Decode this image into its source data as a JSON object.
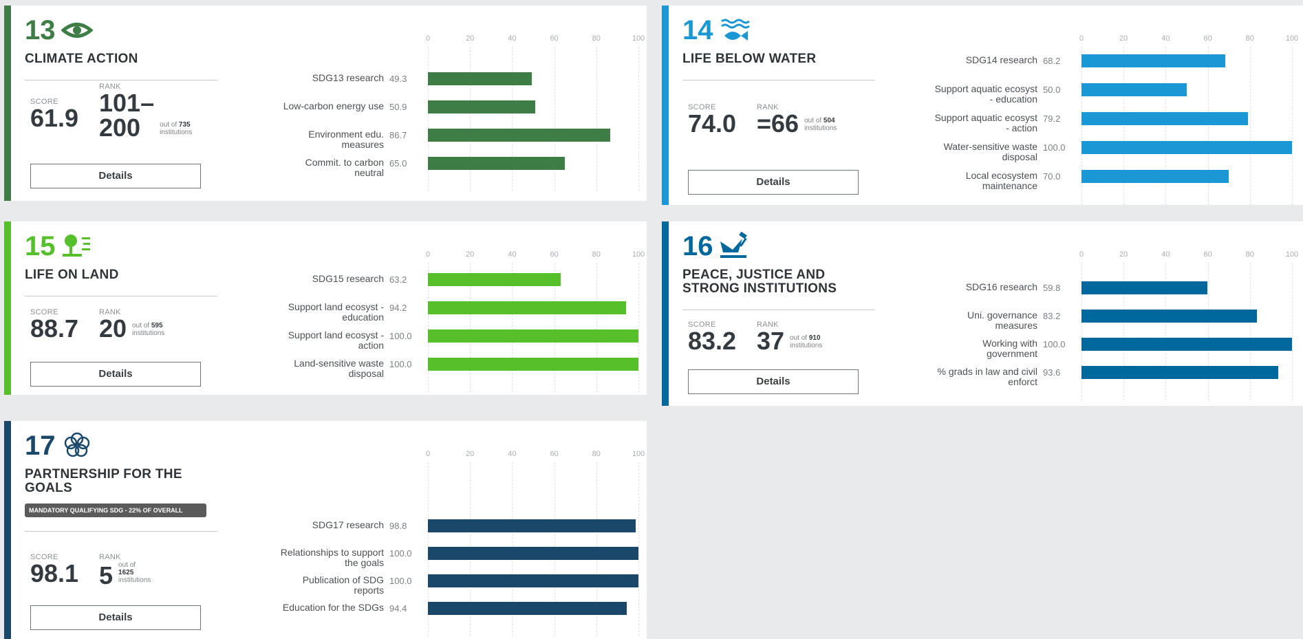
{
  "scale": {
    "ticks": [
      "0",
      "20",
      "40",
      "60",
      "80",
      "100"
    ]
  },
  "labels": {
    "score": "SCORE",
    "rank": "RANK",
    "out_of": "out of",
    "institutions": "institutions",
    "details": "Details"
  },
  "cards": [
    {
      "id": "sdg13",
      "number": "13",
      "title_lines": [
        "CLIMATE ACTION"
      ],
      "color": "#3e7d46",
      "icon": "eye-icon",
      "score": "61.9",
      "rank_lines": [
        "101–",
        "200"
      ],
      "out_of_count": "735",
      "chart_data": {
        "type": "bar",
        "categories": [
          "SDG13 research",
          "Low-carbon energy use",
          "Environment edu. measures",
          "Commit. to carbon neutral"
        ],
        "label_lines": [
          [
            "SDG13 research"
          ],
          [
            "Low-carbon energy use"
          ],
          [
            "Environment edu.",
            "measures"
          ],
          [
            "Commit. to carbon",
            "neutral"
          ]
        ],
        "values": [
          49.3,
          50.9,
          86.7,
          65.0
        ],
        "value_labels": [
          "49.3",
          "50.9",
          "86.7",
          "65.0"
        ],
        "xlim": [
          0,
          100
        ],
        "color": "#3e7d46"
      }
    },
    {
      "id": "sdg14",
      "number": "14",
      "title_lines": [
        "LIFE BELOW WATER"
      ],
      "color": "#1a97d5",
      "icon": "fish-icon",
      "score": "74.0",
      "rank_lines": [
        "=66"
      ],
      "out_of_count": "504",
      "chart_data": {
        "type": "bar",
        "categories": [
          "SDG14 research",
          "Support aquatic ecosyst - education",
          "Support aquatic ecosyst - action",
          "Water-sensitive waste disposal",
          "Local ecosystem maintenance"
        ],
        "label_lines": [
          [
            "SDG14 research"
          ],
          [
            "Support aquatic ecosyst",
            "- education"
          ],
          [
            "Support aquatic ecosyst",
            "- action"
          ],
          [
            "Water-sensitive waste",
            "disposal"
          ],
          [
            "Local ecosystem",
            "maintenance"
          ]
        ],
        "values": [
          68.2,
          50.0,
          79.2,
          100.0,
          70.0
        ],
        "value_labels": [
          "68.2",
          "50.0",
          "79.2",
          "100.0",
          "70.0"
        ],
        "xlim": [
          0,
          100
        ],
        "color": "#1a97d5"
      }
    },
    {
      "id": "sdg15",
      "number": "15",
      "title_lines": [
        "LIFE ON LAND"
      ],
      "color": "#56c02b",
      "icon": "tree-icon",
      "score": "88.7",
      "rank_lines": [
        "20"
      ],
      "out_of_count": "595",
      "chart_data": {
        "type": "bar",
        "categories": [
          "SDG15 research",
          "Support land ecosyst - education",
          "Support land ecosyst - action",
          "Land-sensitive waste disposal"
        ],
        "label_lines": [
          [
            "SDG15 research"
          ],
          [
            "Support land ecosyst -",
            "education"
          ],
          [
            "Support land ecosyst -",
            "action"
          ],
          [
            "Land-sensitive waste",
            "disposal"
          ]
        ],
        "values": [
          63.2,
          94.2,
          100.0,
          100.0
        ],
        "value_labels": [
          "63.2",
          "94.2",
          "100.0",
          "100.0"
        ],
        "xlim": [
          0,
          100
        ],
        "color": "#56c02b"
      }
    },
    {
      "id": "sdg16",
      "number": "16",
      "title_lines": [
        "PEACE, JUSTICE AND",
        "STRONG INSTITUTIONS"
      ],
      "color": "#00689d",
      "icon": "dove-gavel-icon",
      "score": "83.2",
      "rank_lines": [
        "37"
      ],
      "out_of_count": "910",
      "chart_data": {
        "type": "bar",
        "categories": [
          "SDG16 research",
          "Uni. governance measures",
          "Working with government",
          "% grads in law and civil enforct"
        ],
        "label_lines": [
          [
            "SDG16 research"
          ],
          [
            "Uni. governance",
            "measures"
          ],
          [
            "Working with",
            "government"
          ],
          [
            "% grads in law and civil",
            "enforct"
          ]
        ],
        "values": [
          59.8,
          83.2,
          100.0,
          93.6
        ],
        "value_labels": [
          "59.8",
          "83.2",
          "100.0",
          "93.6"
        ],
        "xlim": [
          0,
          100
        ],
        "color": "#00689d"
      }
    },
    {
      "id": "sdg17",
      "number": "17",
      "title_lines": [
        "PARTNERSHIP FOR THE",
        "GOALS"
      ],
      "color": "#19486a",
      "icon": "flower-icon",
      "badge": "MANDATORY QUALIFYING SDG - 22% OF OVERALL",
      "score": "98.1",
      "rank_lines": [
        "5"
      ],
      "out_of_count": "1625",
      "chart_data": {
        "type": "bar",
        "categories": [
          "SDG17 research",
          "Relationships to support the goals",
          "Publication of SDG reports",
          "Education for the SDGs"
        ],
        "label_lines": [
          [
            "SDG17 research"
          ],
          [
            "Relationships to support",
            "the goals"
          ],
          [
            "Publication of SDG",
            "reports"
          ],
          [
            "Education for the SDGs"
          ]
        ],
        "values": [
          98.8,
          100.0,
          100.0,
          94.4
        ],
        "value_labels": [
          "98.8",
          "100.0",
          "100.0",
          "94.4"
        ],
        "xlim": [
          0,
          100
        ],
        "color": "#19486a"
      }
    }
  ]
}
